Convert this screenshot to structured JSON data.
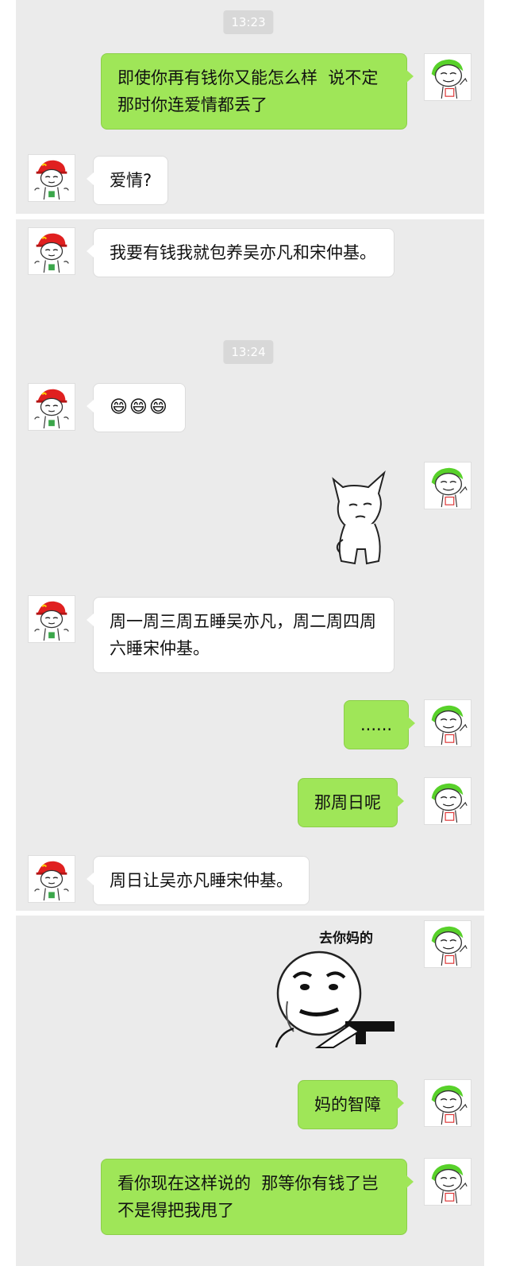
{
  "screenshot_1": {
    "timestamp": "13:23",
    "messages": [
      {
        "from": "me",
        "text": "即使你再有钱你又能怎么样  说不定那时你连爱情都丢了"
      },
      {
        "from": "friend",
        "text": "爱情?"
      }
    ]
  },
  "screenshot_2": {
    "timestamp": "13:24",
    "messages": [
      {
        "from": "friend",
        "text": "我要有钱我就包养吴亦凡和宋仲基。"
      },
      {
        "from": "friend",
        "text": "😄😄😄"
      },
      {
        "from": "me",
        "sticker": "side-eye-cat-sticker"
      },
      {
        "from": "friend",
        "text": "周一周三周五睡吴亦凡，周二周四周六睡宋仲基。"
      },
      {
        "from": "me",
        "text": "......"
      },
      {
        "from": "me",
        "text": "那周日呢"
      },
      {
        "from": "friend",
        "text": "周日让吴亦凡睡宋仲基。"
      }
    ]
  },
  "screenshot_3": {
    "messages": [
      {
        "from": "me",
        "sticker": "gun-meme-sticker",
        "caption": "去你妈的"
      },
      {
        "from": "me",
        "text": "妈的智障"
      },
      {
        "from": "me",
        "text": "看你现在这样说的  那等你有钱了岂不是得把我甩了"
      }
    ]
  },
  "colors": {
    "chat_background": "#ebebeb",
    "sent_bubble": "#9fe658",
    "received_bubble": "#ffffff",
    "timestamp_badge": "#d8d8d8"
  },
  "icons": {
    "my_avatar": "green-hair-meme-avatar",
    "friend_avatar": "red-hat-meme-avatar"
  }
}
